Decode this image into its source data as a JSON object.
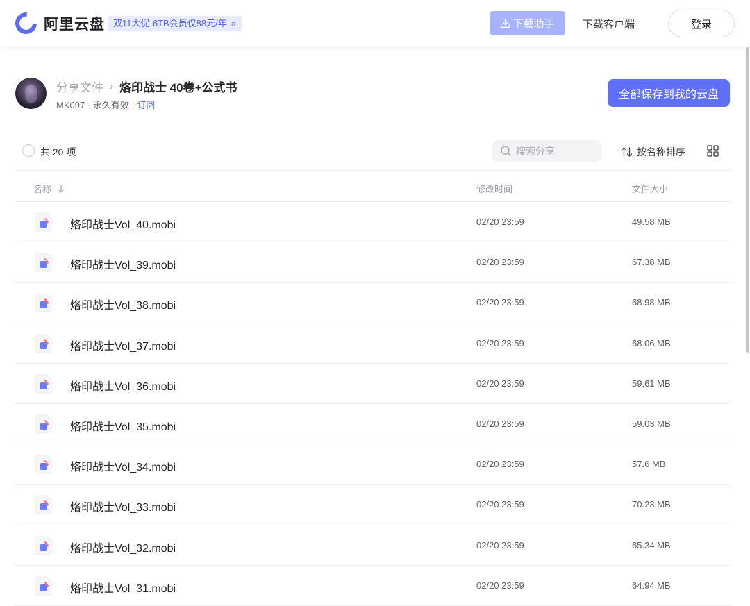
{
  "header": {
    "brand": "阿里云盘",
    "promo": "双11大促-6TB会员仅88元/年",
    "promo_chevron": "»",
    "download_helper": "下载助手",
    "download_client": "下载客户端",
    "login": "登录"
  },
  "share": {
    "crumb_root": "分享文件",
    "crumb_sep": "›",
    "title": "烙印战士 40卷+公式书",
    "owner": "MK097",
    "validity": "永久有效",
    "subscribe": "订阅",
    "save_all": "全部保存到我的云盘"
  },
  "toolbar": {
    "count": "共 20 项",
    "search_placeholder": "搜索分享",
    "sort_label": "按名称排序"
  },
  "table": {
    "columns": {
      "name": "名称",
      "time": "修改时间",
      "size": "文件大小"
    },
    "rows": [
      {
        "name": "烙印战士Vol_40.mobi",
        "time": "02/20 23:59",
        "size": "49.58 MB"
      },
      {
        "name": "烙印战士Vol_39.mobi",
        "time": "02/20 23:59",
        "size": "67.38 MB"
      },
      {
        "name": "烙印战士Vol_38.mobi",
        "time": "02/20 23:59",
        "size": "68.98 MB"
      },
      {
        "name": "烙印战士Vol_37.mobi",
        "time": "02/20 23:59",
        "size": "68.06 MB"
      },
      {
        "name": "烙印战士Vol_36.mobi",
        "time": "02/20 23:59",
        "size": "59.61 MB"
      },
      {
        "name": "烙印战士Vol_35.mobi",
        "time": "02/20 23:59",
        "size": "59.03 MB"
      },
      {
        "name": "烙印战士Vol_34.mobi",
        "time": "02/20 23:59",
        "size": "57.6 MB"
      },
      {
        "name": "烙印战士Vol_33.mobi",
        "time": "02/20 23:59",
        "size": "70.23 MB"
      },
      {
        "name": "烙印战士Vol_32.mobi",
        "time": "02/20 23:59",
        "size": "65.34 MB"
      },
      {
        "name": "烙印战士Vol_31.mobi",
        "time": "02/20 23:59",
        "size": "64.94 MB"
      }
    ]
  },
  "colors": {
    "accent": "#6070f6",
    "accent_light": "#a8b3fb",
    "promo_bg": "#e9ecff"
  },
  "icons": [
    "logo-icon",
    "download-icon",
    "search-icon",
    "sort-icon",
    "grid-view-icon",
    "arrow-down-icon",
    "ebook-file-icon"
  ]
}
